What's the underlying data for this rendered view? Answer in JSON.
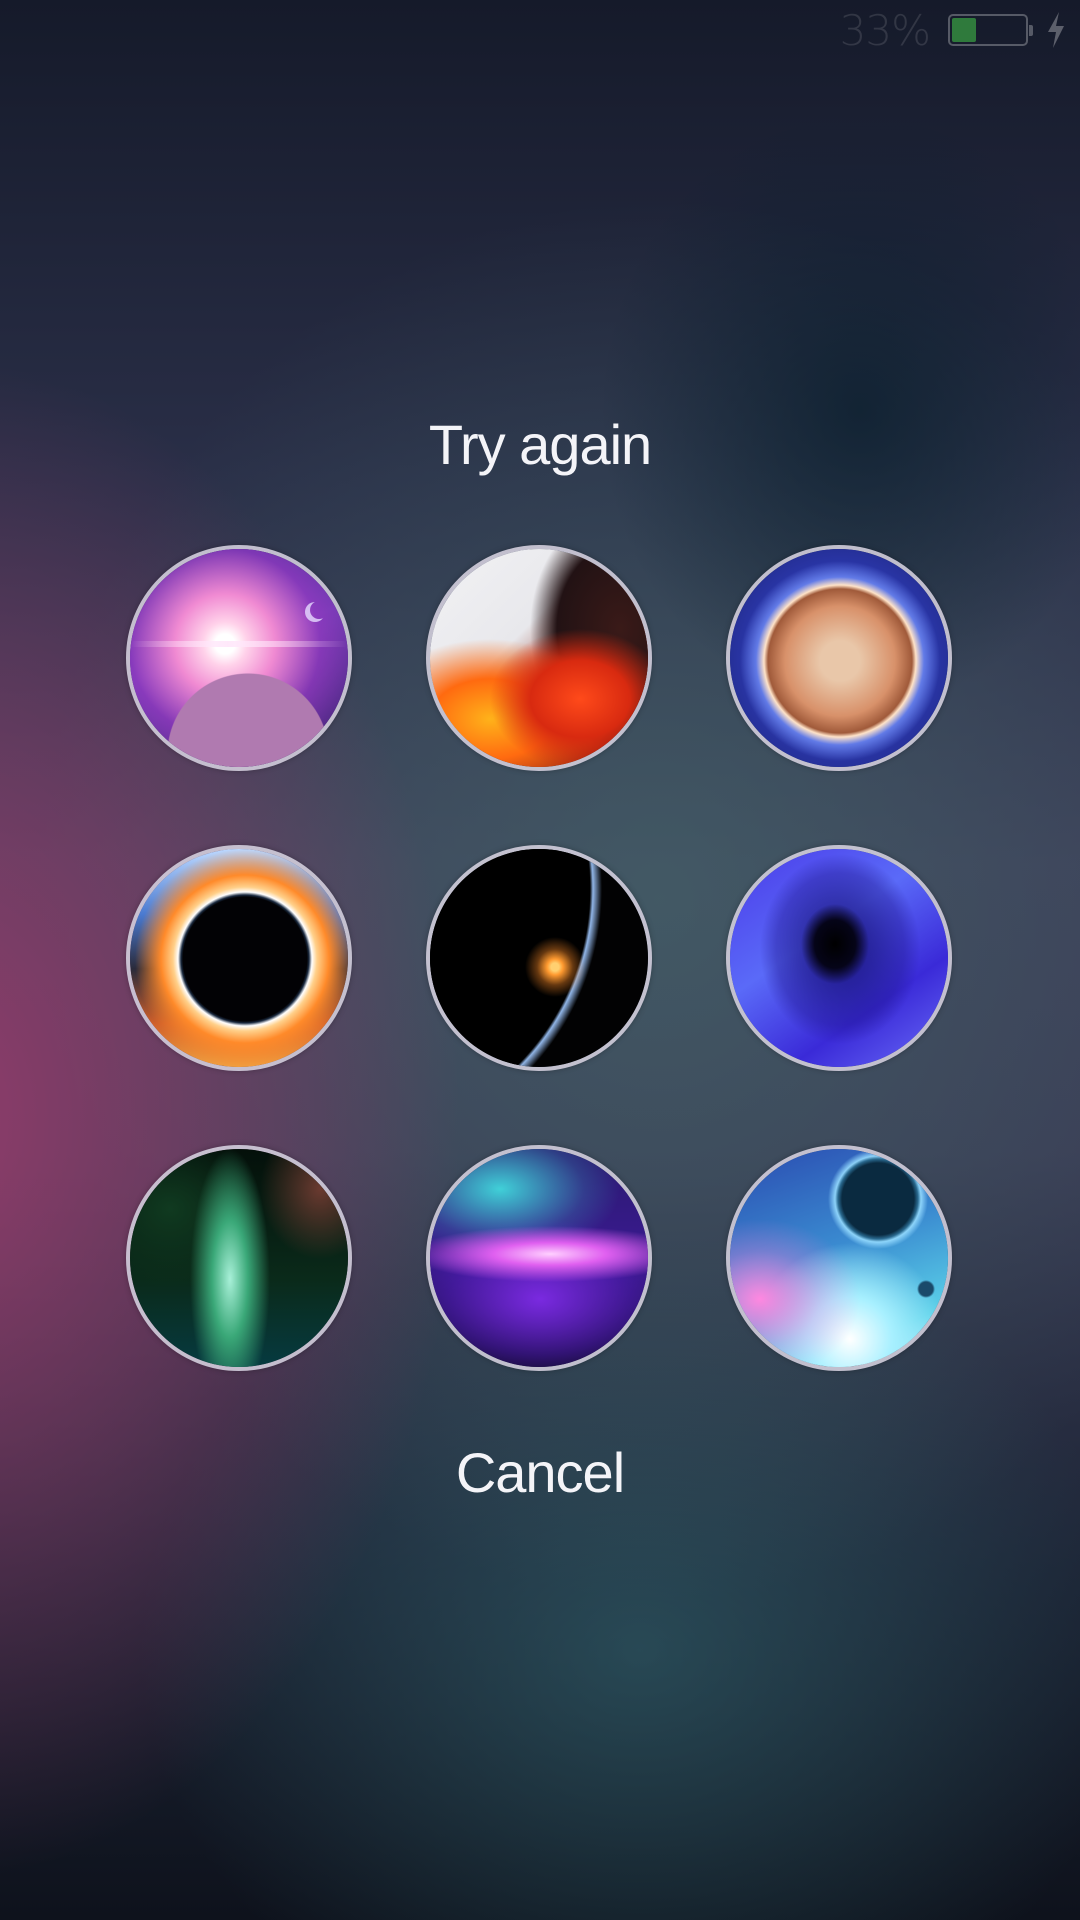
{
  "status_bar": {
    "battery_percent_label": "33%",
    "battery_level": 0.33,
    "battery_fill_color": "#2f7a3c",
    "charging_icon": "lightning-bolt-icon"
  },
  "screen": {
    "title": "Try again",
    "cancel_label": "Cancel",
    "pattern_grid": [
      {
        "id": 1,
        "image": "bright-star-over-purple-planet"
      },
      {
        "id": 2,
        "image": "fiery-red-nebula"
      },
      {
        "id": 3,
        "image": "orange-planet-blue-glow"
      },
      {
        "id": 4,
        "image": "solar-eclipse-orange-blue"
      },
      {
        "id": 5,
        "image": "planet-horizon-sunrise"
      },
      {
        "id": 6,
        "image": "blue-black-hole"
      },
      {
        "id": 7,
        "image": "green-nebula"
      },
      {
        "id": 8,
        "image": "purple-pink-nebula"
      },
      {
        "id": 9,
        "image": "blue-planets-pink-glow"
      }
    ]
  }
}
